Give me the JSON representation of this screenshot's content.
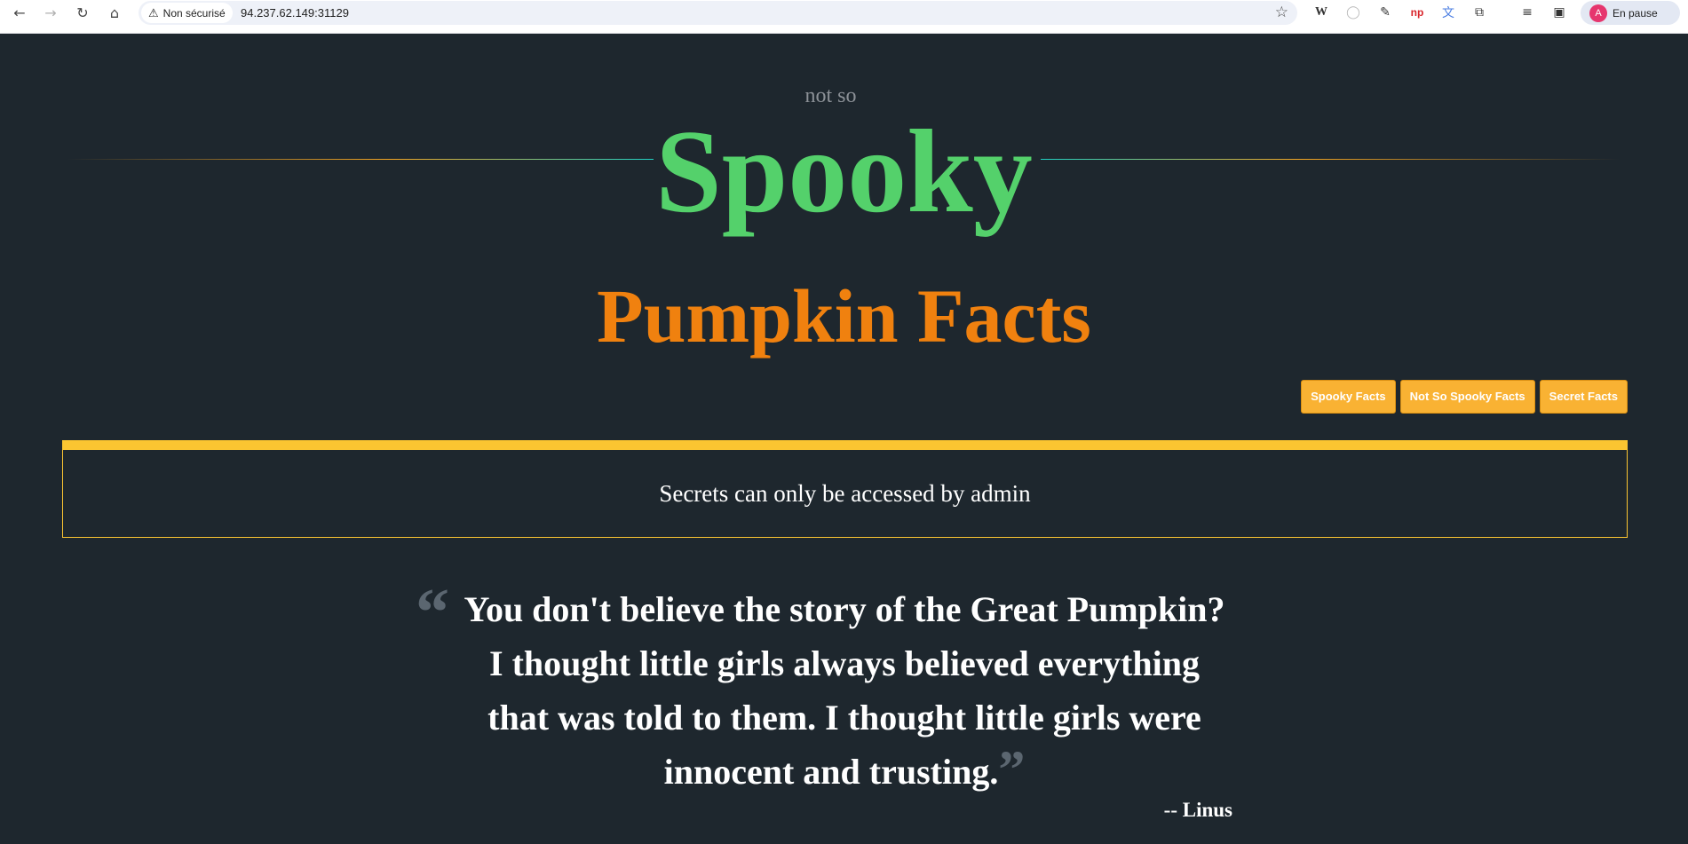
{
  "browser": {
    "nav": {
      "back": "←",
      "forward": "→",
      "reload": "↻",
      "home": "⌂"
    },
    "security_label": "Non sécurisé",
    "url": "94.237.62.149:31129",
    "profile_initial": "A",
    "profile_status": "En pause",
    "extensions": [
      "wikipedia-icon",
      "circle-icon",
      "eyedropper-icon",
      "np-icon",
      "translate-icon",
      "puzzle-icon",
      "playlist-icon",
      "sidepanel-icon",
      "more-icon"
    ]
  },
  "header": {
    "pre": "not so",
    "title": "Spooky",
    "subtitle": "Pumpkin Facts"
  },
  "nav_buttons": [
    "Spooky Facts",
    "Not So Spooky Facts",
    "Secret Facts"
  ],
  "notice": "Secrets can only be accessed by admin",
  "quote": {
    "text": "You don't believe the story of the Great Pumpkin? I thought little girls always believed everything that was told to them. I thought little girls were innocent and trusting.",
    "author": "-- Linus"
  },
  "colors": {
    "background": "#1e272e",
    "spooky_green": "#54d16b",
    "pumpkin_orange": "#f0810f",
    "button": "#f9b233",
    "accent_yellow": "#fbc531"
  }
}
